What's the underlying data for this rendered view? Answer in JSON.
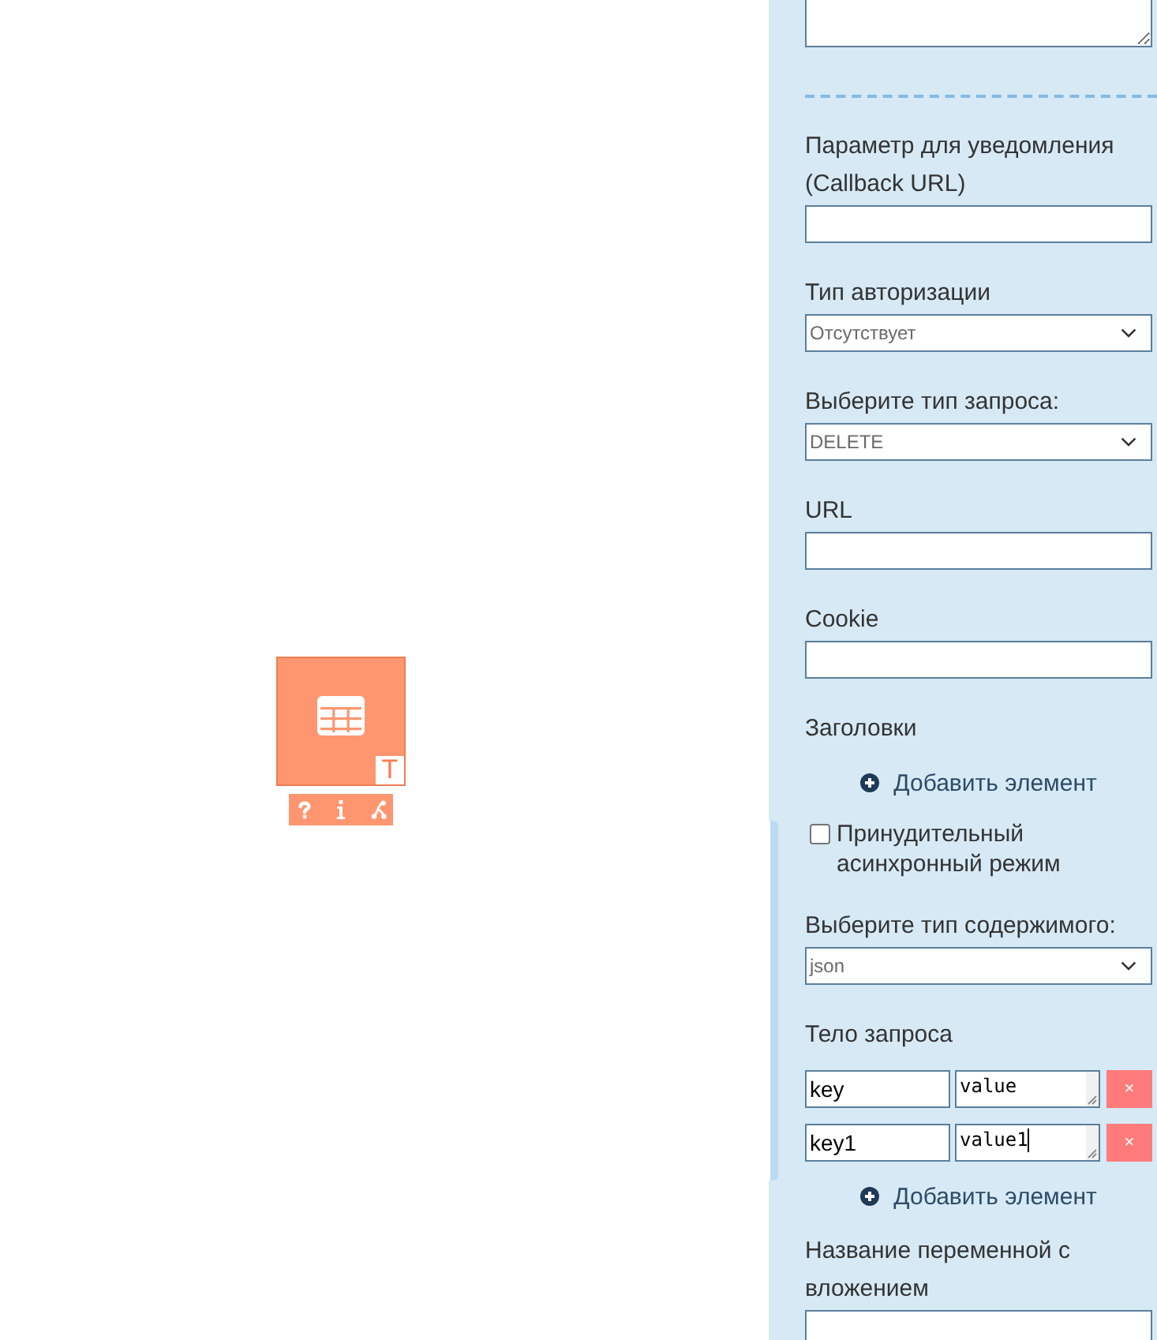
{
  "canvas": {
    "node": {
      "badge": "T"
    }
  },
  "panel": {
    "sections": [
      {
        "kind": "textarea"
      },
      {
        "kind": "divider"
      },
      {
        "kind": "input",
        "label": "Параметр для уведомления (Callback URL)"
      },
      {
        "kind": "select",
        "label": "Тип авторизации",
        "value": "Отсутствует"
      },
      {
        "kind": "select",
        "label": "Выберите тип запроса:",
        "value": "DELETE"
      },
      {
        "kind": "input",
        "label": "URL"
      },
      {
        "kind": "input",
        "label": "Cookie"
      },
      {
        "kind": "pairs",
        "label": "Заголовки",
        "add_label": "Добавить элемент"
      },
      {
        "kind": "checkbox",
        "label": "Принудительный асинхронный режим",
        "checked": false
      },
      {
        "kind": "select",
        "label": "Выберите тип содержимого:",
        "value": "json"
      },
      {
        "kind": "pairs",
        "label": "Тело запроса",
        "rows": [
          {
            "key": "key",
            "value": "value",
            "remove_label": "×",
            "focused": false
          },
          {
            "key": "key1",
            "value": "value1",
            "remove_label": "×",
            "focused": true
          }
        ],
        "add_label": "Добавить элемент"
      },
      {
        "kind": "input",
        "label": "Название переменной с вложением"
      }
    ]
  }
}
